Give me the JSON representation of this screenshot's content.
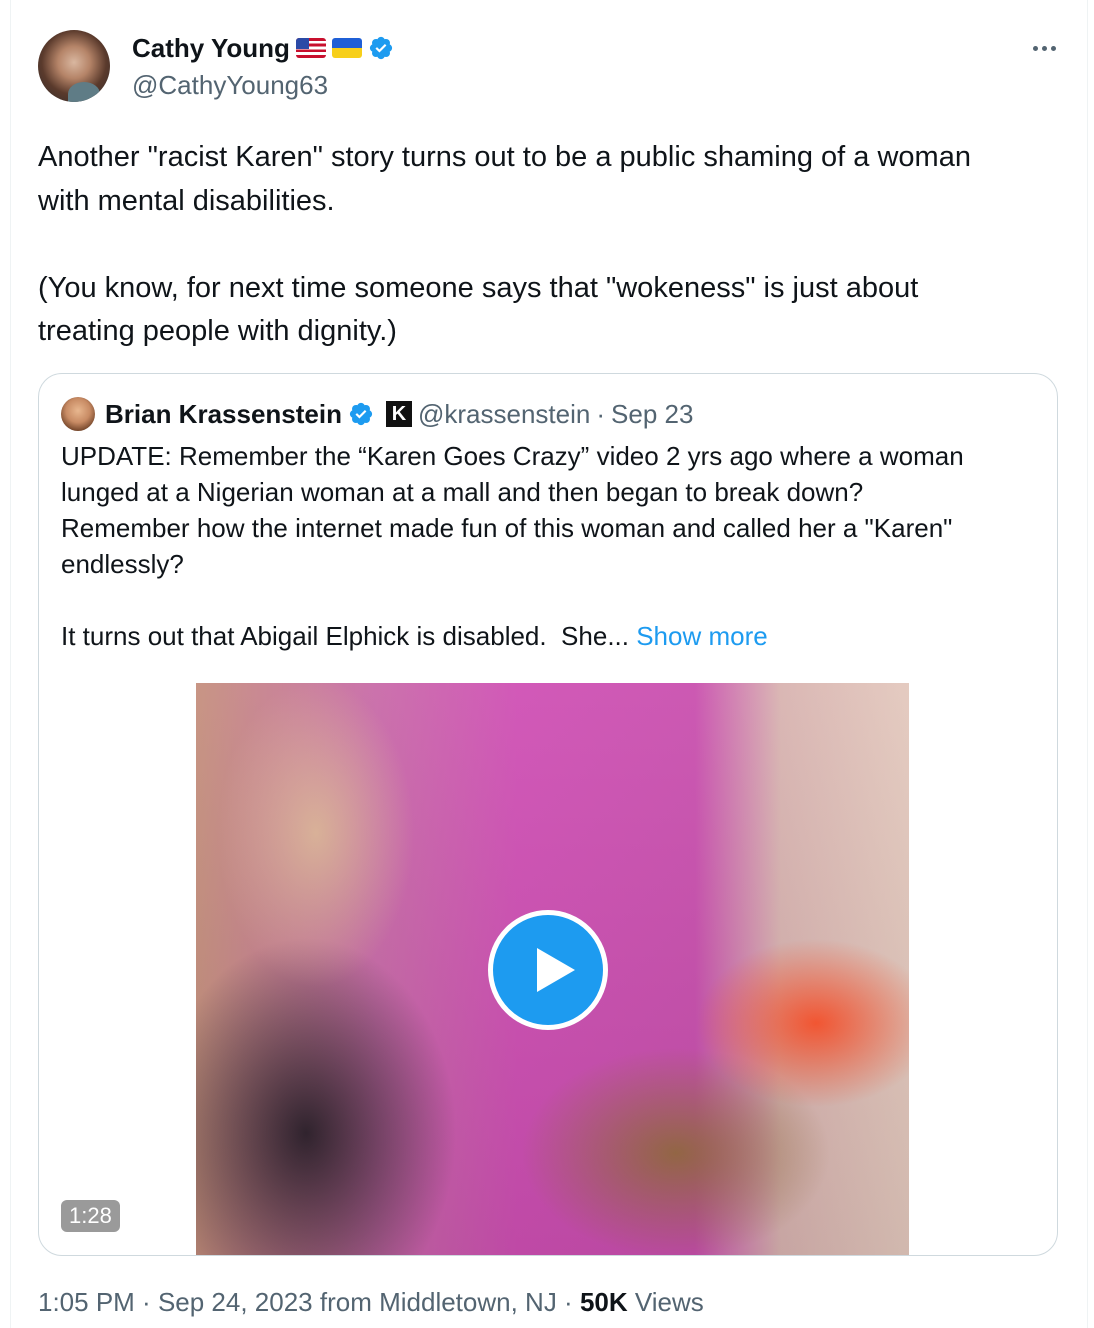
{
  "author": {
    "name": "Cathy Young",
    "flags": [
      "us-flag",
      "ukraine-flag"
    ],
    "verified": true,
    "handle": "@CathyYoung63"
  },
  "tweet": {
    "text": "Another \"racist Karen\" story turns out to be a public shaming of a woman\nwith mental disabilities.\n\n(You know, for next time someone says that \"wokeness\" is just about\ntreating people with dignity.)"
  },
  "quote": {
    "name": "Brian Krassenstein",
    "handle": "@krassenstein",
    "separator": "·",
    "date": "Sep 23",
    "text": "UPDATE: Remember the “Karen Goes Crazy” video 2 yrs ago where a woman\nlunged at a Nigerian woman at a mall and then began to break down?\nRemember how the internet made fun of this woman and called her a \"Karen\"\nendlessly?\n\nIt turns out that Abigail Elphick is disabled.  She... ",
    "show_more": "Show more",
    "badge_letter": "K",
    "video": {
      "duration": "1:28"
    }
  },
  "footer": {
    "time": "1:05 PM",
    "sep1": " · ",
    "date": "Sep 24, 2023",
    "from": " from Middletown, NJ",
    "sep2": " · ",
    "views_count": "50K",
    "views_label": " Views"
  },
  "colors": {
    "accent": "#1d9bf0",
    "muted": "#536471",
    "text": "#0f1419",
    "border": "#cfd9de"
  }
}
